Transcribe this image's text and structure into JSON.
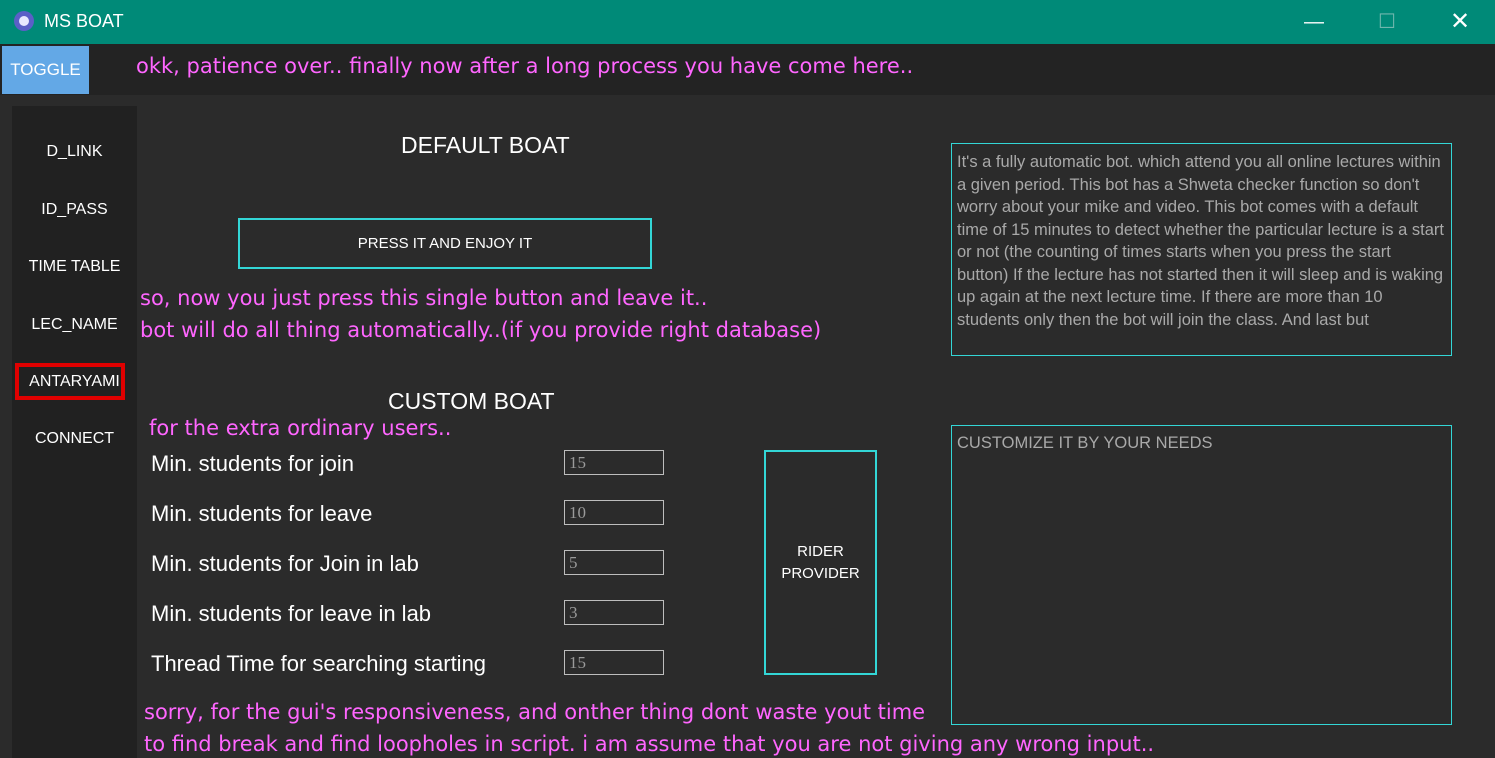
{
  "window": {
    "title": "MS BOAT",
    "minimize_glyph": "—",
    "maximize_glyph": "☐",
    "close_glyph": "✕",
    "accent_color": "#008a78"
  },
  "toolbar": {
    "toggle_label": "TOGGLE",
    "message": "okk, patience over.. finally now after a long process you have come here.."
  },
  "sidebar": {
    "items": [
      {
        "label": "D_LINK"
      },
      {
        "label": "ID_PASS"
      },
      {
        "label": "TIME TABLE"
      },
      {
        "label": "LEC_NAME"
      },
      {
        "label": "ANTARYAMI",
        "active": true
      },
      {
        "label": "CONNECT"
      }
    ]
  },
  "default_boat": {
    "title": "DEFAULT BOAT",
    "button_label": "PRESS IT AND ENJOY IT",
    "note_line1": "so, now you just press this single button and leave it..",
    "note_line2": "bot will do all thing automatically..(if you provide right database)"
  },
  "info_text": "It's a fully automatic bot. which attend you all online lectures within a given period. This bot has a Shweta checker function so don't worry about your mike and video. This bot comes with a default time of 15 minutes to detect whether the particular lecture is a start or not (the counting of times starts when you press the start button) If the lecture has not started then it will sleep and is waking up again at the next lecture time. If there are more than 10 students only then the bot will join the class. And last but",
  "custom_boat": {
    "title": "CUSTOM BOAT",
    "subtitle": "for the extra ordinary users..",
    "fields": [
      {
        "label": "Min.  students for join",
        "value": "15"
      },
      {
        "label": "Min. students for leave",
        "value": "10"
      },
      {
        "label": "Min. students for Join in lab",
        "value": "5"
      },
      {
        "label": "Min. students for leave in lab",
        "value": "3"
      },
      {
        "label": "Thread Time for searching starting",
        "value": "15"
      }
    ],
    "rider_line1": "RIDER",
    "rider_line2": "PROVIDER",
    "customize_placeholder": "CUSTOMIZE IT BY YOUR NEEDS"
  },
  "footer": {
    "line1": "sorry, for the gui's responsiveness, and onther thing dont waste yout time",
    "line2": "to find break and find loopholes in script. i am assume that you are not giving any wrong input.."
  },
  "colors": {
    "cyan_border": "#33d6d6",
    "pink_text": "#ff66ff",
    "active_frame": "#e00000",
    "toggle_bg": "#63a8e6"
  }
}
